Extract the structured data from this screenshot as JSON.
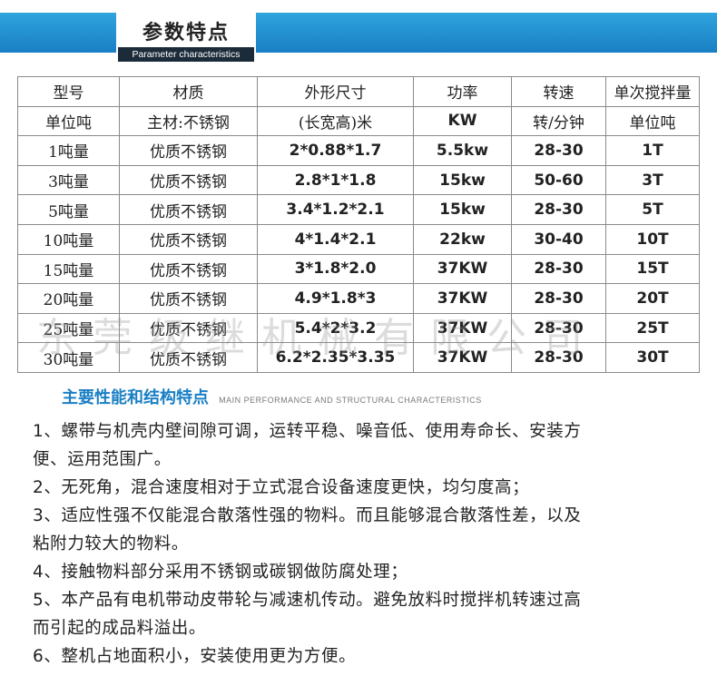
{
  "banner": {
    "title": "参数特点",
    "subtitle": "Parameter characteristics"
  },
  "table": {
    "header": [
      "型号",
      "材质",
      "外形尺寸",
      "功率",
      "转速",
      "单次搅拌量"
    ],
    "units": [
      "单位吨",
      "主材:不锈钢",
      "(长宽高)米",
      "KW",
      "转/分钟",
      "单位吨"
    ],
    "rows": [
      [
        "1吨量",
        "优质不锈钢",
        "2*0.88*1.7",
        "5.5kw",
        "28-30",
        "1T"
      ],
      [
        "3吨量",
        "优质不锈钢",
        "2.8*1*1.8",
        "15kw",
        "50-60",
        "3T"
      ],
      [
        "5吨量",
        "优质不锈钢",
        "3.4*1.2*2.1",
        "15kw",
        "28-30",
        "5T"
      ],
      [
        "10吨量",
        "优质不锈钢",
        "4*1.4*2.1",
        "22kw",
        "30-40",
        "10T"
      ],
      [
        "15吨量",
        "优质不锈钢",
        "3*1.8*2.0",
        "37KW",
        "28-30",
        "15T"
      ],
      [
        "20吨量",
        "优质不锈钢",
        "4.9*1.8*3",
        "37KW",
        "28-30",
        "20T"
      ],
      [
        "25吨量",
        "优质不锈钢",
        "5.4*2*3.2",
        "37KW",
        "28-30",
        "25T"
      ],
      [
        "30吨量",
        "优质不锈钢",
        "6.2*2.35*3.35",
        "37KW",
        "28-30",
        "30T"
      ]
    ]
  },
  "watermark": "东莞级继机械有限公司",
  "section": {
    "title": "主要性能和结构特点",
    "subtitle": "MAIN PERFORMANCE AND STRUCTURAL CHARACTERISTICS"
  },
  "features": [
    "1、螺带与机壳内壁间隙可调，运转平稳、噪音低、使用寿命长、安装方",
    "便、运用范围广。",
    "2、无死角，混合速度相对于立式混合设备速度更快，均匀度高；",
    "3、适应性强不仅能混合散落性强的物料。而且能够混合散落性差，以及",
    "粘附力较大的物料。",
    "4、接触物料部分采用不锈钢或碳钢做防腐处理；",
    "5、本产品有电机带动皮带轮与减速机传动。避免放料时搅拌机转速过高",
    "而引起的成品料溢出。",
    "6、整机占地面积小，安装使用更为方便。"
  ],
  "colors": {
    "banner_blue": "#1a7fc4",
    "section_blue": "#1a7fc4",
    "subtitle_bg": "#1c2b3a"
  }
}
